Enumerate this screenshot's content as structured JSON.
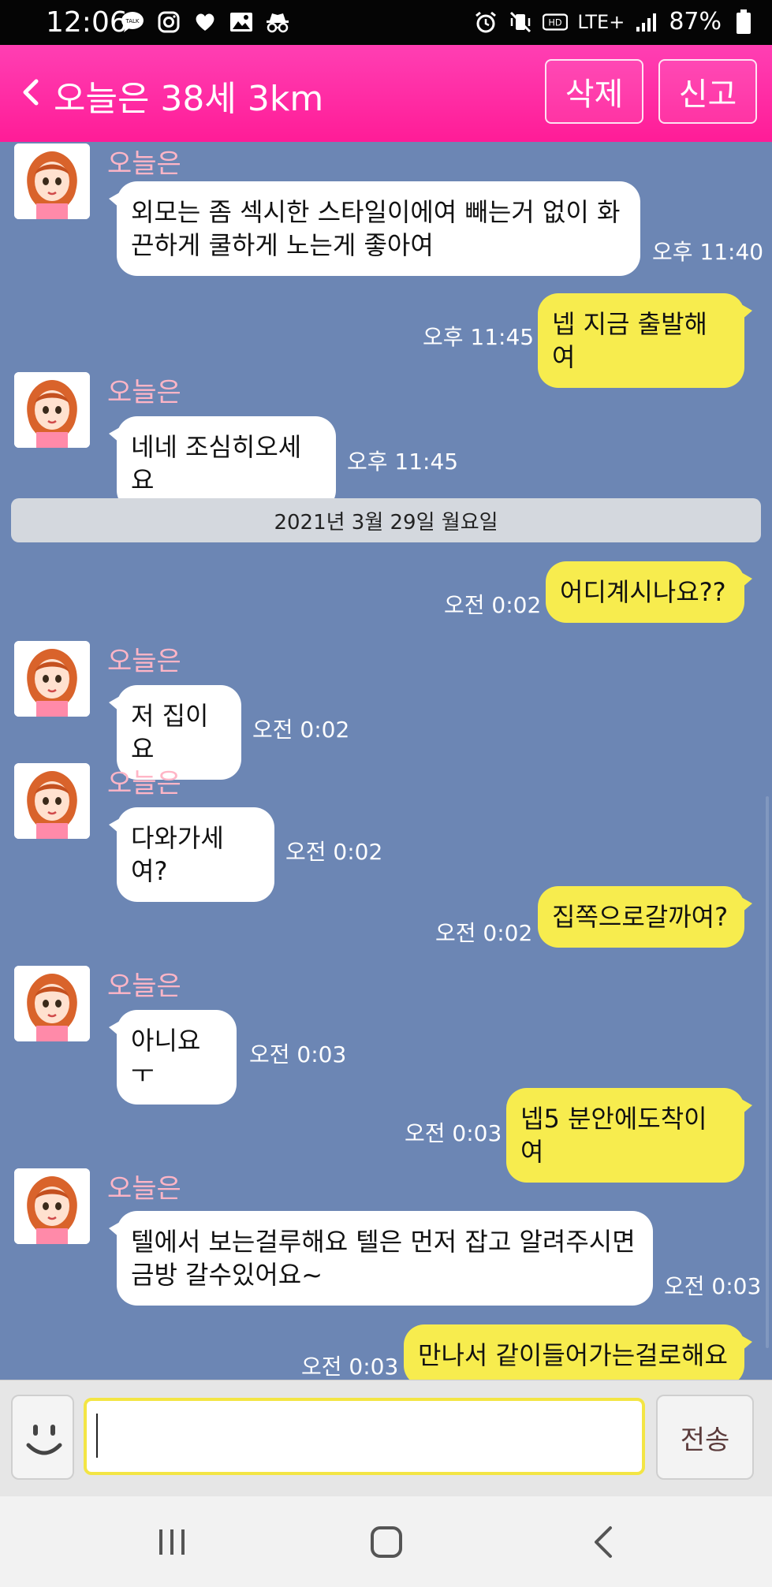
{
  "status_bar": {
    "time": "12:06",
    "battery": "87%",
    "network": "LTE+",
    "left_icons": [
      "talk-icon",
      "instagram-icon",
      "heart-icon",
      "gallery-icon",
      "incognito-icon"
    ],
    "right_icons": [
      "alarm-icon",
      "vibrate-icon",
      "hd-icon",
      "lte-icon",
      "signal-icon",
      "battery-icon"
    ]
  },
  "header": {
    "title": "오늘은 38세 3km",
    "delete_label": "삭제",
    "report_label": "신고",
    "color": "#ff2a9f"
  },
  "chat": {
    "date_divider": "2021년 3월 29일 월요일",
    "messages": [
      {
        "from": "them",
        "sender": "오늘은",
        "text": "외모는 좀 섹시한 스타일이에여 빼는거 없이 화끈하게 쿨하게 노는게 좋아여",
        "time": "오후 11:40"
      },
      {
        "from": "me",
        "text": "넵 지금 출발해여",
        "time": "오후 11:45"
      },
      {
        "from": "them",
        "sender": "오늘은",
        "text": "네네 조심히오세요",
        "time": "오후 11:45"
      },
      {
        "from": "me",
        "text": "어디계시나요??",
        "time": "오전 0:02"
      },
      {
        "from": "them",
        "sender": "오늘은",
        "text": "저 집이요",
        "time": "오전 0:02"
      },
      {
        "from": "them",
        "sender": "오늘은",
        "text": "다와가세여?",
        "time": "오전 0:02"
      },
      {
        "from": "me",
        "text": "집쪽으로갈까여?",
        "time": "오전 0:02"
      },
      {
        "from": "them",
        "sender": "오늘은",
        "text": "아니요ㅜ",
        "time": "오전 0:03"
      },
      {
        "from": "me",
        "text": "넵5 분안에도착이여",
        "time": "오전 0:03"
      },
      {
        "from": "them",
        "sender": "오늘은",
        "text": "텔에서 보는걸루해요 텔은 먼저 잡고 알려주시면 금방 갈수있어요~",
        "time": "오전 0:03"
      },
      {
        "from": "me",
        "text": "만나서 같이들어가는걸로해요",
        "time": "오전 0:03"
      }
    ]
  },
  "input": {
    "value": "",
    "send_label": "전송"
  },
  "colors": {
    "chat_bg": "#6c86b4",
    "my_bubble": "#f7ec4e",
    "their_bubble": "#ffffff",
    "sender_name": "#ffb5c6"
  }
}
